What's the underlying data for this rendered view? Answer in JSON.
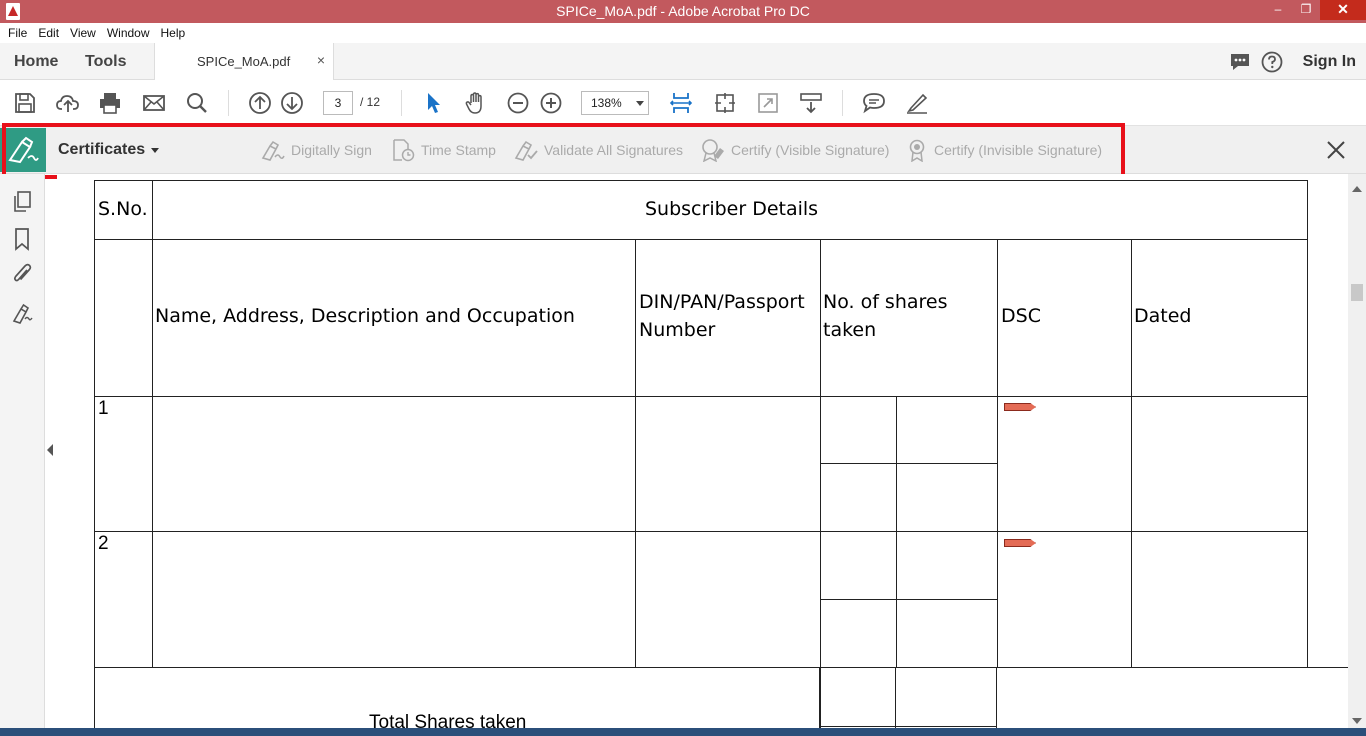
{
  "window": {
    "title": "SPICe_MoA.pdf - Adobe Acrobat Pro DC",
    "minimize": "–",
    "restore": "❐",
    "close": "✕"
  },
  "menu": [
    "File",
    "Edit",
    "View",
    "Window",
    "Help"
  ],
  "tabs": {
    "home": "Home",
    "tools": "Tools",
    "document": "SPICe_MoA.pdf",
    "close_symbol": "×",
    "sign_in": "Sign In"
  },
  "toolbar": {
    "page_current": "3",
    "page_total": "/  12",
    "zoom": "138%"
  },
  "certificates": {
    "label": "Certificates",
    "tools": [
      "Digitally Sign",
      "Time Stamp",
      "Validate All Signatures",
      "Certify (Visible Signature)",
      "Certify (Invisible Signature)"
    ]
  },
  "document": {
    "headers": {
      "sno": "S.No.",
      "subscriber": "Subscriber Details",
      "name": "Name, Address, Description and Occupation",
      "din_1": "DIN/PAN/Passport",
      "din_2": "Number",
      "shares_1": "No. of shares",
      "shares_2": "taken",
      "dsc": "DSC",
      "dated": "Dated"
    },
    "rows": [
      "1",
      "2"
    ],
    "total_label": "Total Shares taken"
  },
  "colors": {
    "titlebar": "#c2595e",
    "accent": "#2f9b84",
    "highlight": "#e8101a",
    "blue": "#1a73c8"
  }
}
